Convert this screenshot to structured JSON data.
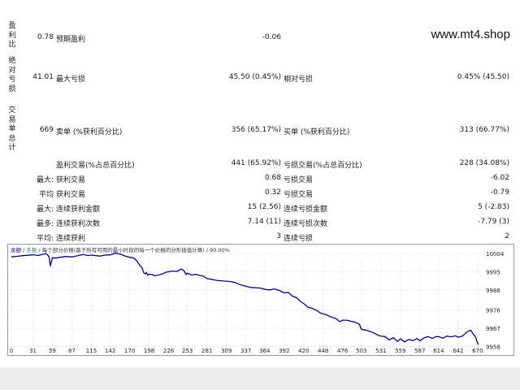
{
  "watermark": "www.mt4.shop",
  "section_labels": {
    "profit_ratio": "盈利比",
    "absolute_drawdown": "绝对亏损",
    "trade_summary": "交易单总计"
  },
  "rows": {
    "r1": {
      "v1": "0.78",
      "l2": "预期盈利",
      "v2": "-0.06"
    },
    "r2": {
      "v1": "41.01",
      "l2": "最大亏损",
      "v2": "45.50 (0.45%)",
      "l3": "相对亏损",
      "v3": "0.45% (45.50)"
    },
    "r3": {
      "v1": "669",
      "l2": "卖单 (%获利百分比)",
      "v2": "356 (65.17%)",
      "l3": "买单 (%获利百分比)",
      "v3": "313 (66.77%)"
    },
    "r4": {
      "l2": "盈利交易(%占总百分比)",
      "v2": "441 (65.92%)",
      "l3": "亏损交易(%占总百分比)",
      "v3": "228 (34.08%)"
    },
    "r5": {
      "l1": "最大:",
      "l2": "获利交易",
      "v2": "0.68",
      "l3": "亏损交易",
      "v3": "-6.02"
    },
    "r6": {
      "l1": "平均",
      "l2": "获利交易",
      "v2": "0.32",
      "l3": "亏损交易",
      "v3": "-0.79"
    },
    "r7": {
      "l1": "最大:",
      "l2": "连续获利金额",
      "v2": "15 (2.56)",
      "l3": "连续亏损金额",
      "v3": "5 (-2.83)"
    },
    "r8": {
      "l1": "最多:",
      "l2": "连续获利次数",
      "v2": "7.14 (11)",
      "l3": "连续亏损次数",
      "v3": "-7.79 (3)"
    },
    "r9": {
      "l1": "平均:",
      "l2": "连续获利",
      "v2": "3",
      "l3": "连续亏损",
      "v3": "2"
    }
  },
  "chart_data": {
    "type": "line",
    "legend_text": [
      "余额",
      "/",
      "手数",
      "/",
      "每个部分价格(基于所有可用的最小时段的每一个价格的分形插值计算)",
      "/",
      "90.00%"
    ],
    "legend_colors": {
      "balance": "#00008b",
      "lots": "#2e8b57",
      "text": "#333333"
    },
    "series": [
      {
        "name": "余额",
        "color": "#00008b",
        "x": [
          0,
          8,
          16,
          24,
          31,
          38,
          45,
          50,
          54,
          56,
          59,
          63,
          70,
          78,
          87,
          95,
          103,
          110,
          115,
          120,
          127,
          134,
          142,
          150,
          158,
          163,
          170,
          176,
          180,
          185,
          188,
          190,
          192,
          194,
          196,
          198,
          202,
          206,
          212,
          218,
          222,
          226,
          232,
          238,
          244,
          248,
          251,
          253,
          256,
          260,
          265,
          270,
          276,
          281,
          288,
          295,
          302,
          309,
          316,
          323,
          330,
          337,
          344,
          351,
          358,
          365,
          372,
          378,
          385,
          392,
          398,
          404,
          410,
          416,
          420,
          426,
          432,
          438,
          444,
          448,
          454,
          460,
          466,
          472,
          476,
          482,
          488,
          494,
          500,
          503,
          509,
          515,
          521,
          527,
          531,
          537,
          543,
          549,
          555,
          559,
          565,
          571,
          577,
          583,
          587,
          593,
          599,
          605,
          610,
          614,
          620,
          626,
          632,
          638,
          642,
          648,
          654,
          660,
          664,
          667,
          669,
          671
        ],
        "y": [
          10002.3,
          10002.6,
          10002.9,
          10003.1,
          10003.4,
          10003.0,
          10003.6,
          10003.9,
          10002.6,
          9997.8,
          10001.9,
          10001.7,
          10002.1,
          10002.5,
          10002.3,
          10002.9,
          10003.5,
          10003.0,
          10003.2,
          10003.0,
          10002.7,
          10003.2,
          10003.3,
          10004.2,
          10003.5,
          10002.8,
          10002.1,
          10001.8,
          10000.4,
          9997.9,
          9996.9,
          9994.6,
          9993.9,
          9994.6,
          9993.2,
          9993.8,
          9993.6,
          9993.0,
          9993.4,
          9994.0,
          9994.7,
          9995.0,
          9995.3,
          9995.1,
          9996.3,
          9995.5,
          9993.6,
          9994.3,
          9993.7,
          9993.4,
          9993.7,
          9993.2,
          9992.8,
          9991.6,
          9991.2,
          9990.7,
          9990.5,
          9990.3,
          9990.1,
          9989.4,
          9988.4,
          9987.8,
          9987.2,
          9987.1,
          9986.9,
          9986.2,
          9986.0,
          9986.5,
          9985.7,
          9984.5,
          9984.8,
          9982.9,
          9982.1,
          9980.1,
          9979.3,
          9977.5,
          9976.9,
          9976.0,
          9974.6,
          9974.2,
          9973.5,
          9972.5,
          9971.9,
          9970.3,
          9971.0,
          9971.0,
          9970.5,
          9970.0,
          9969.0,
          9966.5,
          9966.1,
          9965.5,
          9964.7,
          9963.6,
          9963.2,
          9962.9,
          9961.3,
          9962.4,
          9960.5,
          9961.8,
          9960.3,
          9961.5,
          9960.9,
          9962.0,
          9960.8,
          9962.3,
          9962.9,
          9962.0,
          9962.9,
          9962.9,
          9962.1,
          9963.2,
          9962.8,
          9963.3,
          9962.6,
          9963.1,
          9965.1,
          9966.1,
          9964.0,
          9962.8,
          9960.5,
          9958.9
        ]
      }
    ],
    "x_ticks": [
      0,
      31,
      59,
      87,
      115,
      142,
      170,
      198,
      226,
      253,
      281,
      309,
      337,
      364,
      392,
      420,
      448,
      476,
      503,
      531,
      559,
      587,
      614,
      642,
      670
    ],
    "y_ticks": [
      10004,
      9995,
      9986,
      9976,
      9967,
      9958
    ],
    "xlim": [
      0,
      676
    ],
    "ylim": [
      9957,
      10006
    ],
    "grid": true
  }
}
